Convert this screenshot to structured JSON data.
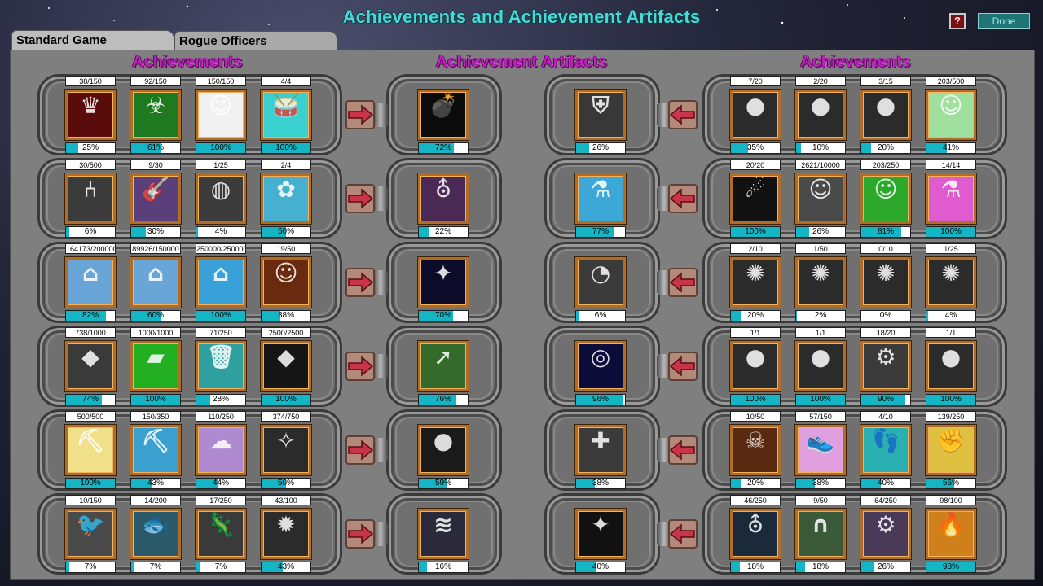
{
  "window": {
    "title": "Achievements and Achievement Artifacts",
    "help_label": "?",
    "done_label": "Done"
  },
  "tabs": [
    {
      "label": "Standard Game",
      "active": true
    },
    {
      "label": "Rogue Officers",
      "active": false
    }
  ],
  "headings": {
    "left": "Achievements",
    "middle": "Achievement Artifacts",
    "right": "Achievements"
  },
  "colors": {
    "progress_fill": "#14b6c6",
    "frame_border": "#b06d28",
    "heading": "#c21fc2",
    "title": "#48d8d8",
    "arrow": "#c8344a"
  },
  "rows": [
    {
      "left": [
        {
          "count": "38/150",
          "pct": "25%",
          "fill": 25,
          "icon": "magic-hat-icon",
          "bg": "#5a0c0c"
        },
        {
          "count": "92/150",
          "pct": "61%",
          "fill": 61,
          "icon": "biohazard-icon",
          "bg": "#1f7a1f"
        },
        {
          "count": "150/150",
          "pct": "100%",
          "fill": 100,
          "icon": "scientist-icon",
          "bg": "#f1f1f1"
        },
        {
          "count": "4/4",
          "pct": "100%",
          "fill": 100,
          "icon": "drum-icon",
          "bg": "#3ad0d0"
        }
      ],
      "left_artifact": {
        "pct": "72%",
        "fill": 72,
        "icon": "bomb-icon",
        "bg": "#0b0b0b"
      },
      "right_artifact": {
        "pct": "26%",
        "fill": 26,
        "icon": "shield-gear-icon",
        "bg": "#383838"
      },
      "right": [
        {
          "count": "7/20",
          "pct": "35%",
          "fill": 35,
          "icon": "moon-icon",
          "bg": "#2b2b2b"
        },
        {
          "count": "2/20",
          "pct": "10%",
          "fill": 10,
          "icon": "brown-planet-icon",
          "bg": "#2b2b2b"
        },
        {
          "count": "3/15",
          "pct": "20%",
          "fill": 20,
          "icon": "mars-icon",
          "bg": "#2b2b2b"
        },
        {
          "count": "203/500",
          "pct": "41%",
          "fill": 41,
          "icon": "zookeeper-icon",
          "bg": "#9fe09f"
        }
      ]
    },
    {
      "left": [
        {
          "count": "30/500",
          "pct": "6%",
          "fill": 6,
          "icon": "chair-icon",
          "bg": "#3b3b3b"
        },
        {
          "count": "9/30",
          "pct": "30%",
          "fill": 30,
          "icon": "guitar-icon",
          "bg": "#5b3f7a"
        },
        {
          "count": "1/25",
          "pct": "4%",
          "fill": 4,
          "icon": "copper-disc-icon",
          "bg": "#3b3b3b"
        },
        {
          "count": "2/4",
          "pct": "50%",
          "fill": 50,
          "icon": "spices-icon",
          "bg": "#46b0d0"
        }
      ],
      "left_artifact": {
        "pct": "22%",
        "fill": 22,
        "icon": "ufo-beam-icon",
        "bg": "#4a2a55"
      },
      "right_artifact": {
        "pct": "77%",
        "fill": 77,
        "icon": "flask-plus-icon",
        "bg": "#3ba8d8"
      },
      "right": [
        {
          "count": "20/20",
          "pct": "100%",
          "fill": 100,
          "icon": "comet-icon",
          "bg": "#111111"
        },
        {
          "count": "2621/10000",
          "pct": "26%",
          "fill": 26,
          "icon": "scientist-portrait-icon",
          "bg": "#4a4a4a"
        },
        {
          "count": "203/250",
          "pct": "81%",
          "fill": 81,
          "icon": "robber-icon",
          "bg": "#2ca82c"
        },
        {
          "count": "14/14",
          "pct": "100%",
          "fill": 100,
          "icon": "flasks-icon",
          "bg": "#e05ad0"
        }
      ]
    },
    {
      "left": [
        {
          "count": "164173/200000",
          "pct": "82%",
          "fill": 82,
          "icon": "house-for-sale-icon",
          "bg": "#6aa5d8"
        },
        {
          "count": "89926/150000",
          "pct": "60%",
          "fill": 60,
          "icon": "house-sold-icon",
          "bg": "#6aa5d8"
        },
        {
          "count": "250000/250000",
          "pct": "100%",
          "fill": 100,
          "icon": "shop-icon",
          "bg": "#3aa0d8"
        },
        {
          "count": "19/50",
          "pct": "38%",
          "fill": 38,
          "icon": "bearded-man-icon",
          "bg": "#6a2a10"
        }
      ],
      "left_artifact": {
        "pct": "70%",
        "fill": 70,
        "icon": "satellite-icon",
        "bg": "#0c0c2a"
      },
      "right_artifact": {
        "pct": "6%",
        "fill": 6,
        "icon": "gauge-icon",
        "bg": "#3b3b3b"
      },
      "right": [
        {
          "count": "2/10",
          "pct": "20%",
          "fill": 20,
          "icon": "galaxy-icon",
          "bg": "#2b2b2b"
        },
        {
          "count": "1/50",
          "pct": "2%",
          "fill": 2,
          "icon": "green-spiral-icon",
          "bg": "#2b2b2b"
        },
        {
          "count": "0/10",
          "pct": "0%",
          "fill": 0,
          "icon": "red-spiral-icon",
          "bg": "#2b2b2b"
        },
        {
          "count": "1/25",
          "pct": "4%",
          "fill": 4,
          "icon": "gold-spiral-icon",
          "bg": "#2b2b2b"
        }
      ]
    },
    {
      "left": [
        {
          "count": "738/1000",
          "pct": "74%",
          "fill": 74,
          "icon": "gold-nugget-icon",
          "bg": "#3a3a3a"
        },
        {
          "count": "1000/1000",
          "pct": "100%",
          "fill": 100,
          "icon": "silver-bar-icon",
          "bg": "#22b022"
        },
        {
          "count": "71/250",
          "pct": "28%",
          "fill": 28,
          "icon": "trash-can-icon",
          "bg": "#2ea0a0"
        },
        {
          "count": "2500/2500",
          "pct": "100%",
          "fill": 100,
          "icon": "gems-icon",
          "bg": "#151515"
        }
      ],
      "left_artifact": {
        "pct": "76%",
        "fill": 76,
        "icon": "map-arrow-icon",
        "bg": "#356b2a"
      },
      "right_artifact": {
        "pct": "96%",
        "fill": 96,
        "icon": "target-icon",
        "bg": "#0c0c3a"
      },
      "right": [
        {
          "count": "1/1",
          "pct": "100%",
          "fill": 100,
          "icon": "silver-planet-icon",
          "bg": "#2b2b2b"
        },
        {
          "count": "1/1",
          "pct": "100%",
          "fill": 100,
          "icon": "rainbow-orb-icon",
          "bg": "#2b2b2b"
        },
        {
          "count": "18/20",
          "pct": "90%",
          "fill": 90,
          "icon": "robot-parts-icon",
          "bg": "#3a3a3a"
        },
        {
          "count": "1/1",
          "pct": "100%",
          "fill": 100,
          "icon": "red-planet-icon",
          "bg": "#2b2b2b"
        }
      ]
    },
    {
      "left": [
        {
          "count": "500/500",
          "pct": "100%",
          "fill": 100,
          "icon": "crystal-drill-icon",
          "bg": "#f0e08a"
        },
        {
          "count": "150/350",
          "pct": "43%",
          "fill": 43,
          "icon": "oil-drill-icon",
          "bg": "#3aa0d0"
        },
        {
          "count": "110/250",
          "pct": "44%",
          "fill": 44,
          "icon": "cloud-drill-icon",
          "bg": "#b08ad0"
        },
        {
          "count": "374/750",
          "pct": "50%",
          "fill": 50,
          "icon": "insect-icon",
          "bg": "#2b2b2b"
        }
      ],
      "left_artifact": {
        "pct": "59%",
        "fill": 59,
        "icon": "green-planet-icon",
        "bg": "#1a1a1a"
      },
      "right_artifact": {
        "pct": "38%",
        "fill": 38,
        "icon": "hands-plus-icon",
        "bg": "#3b3b3b"
      },
      "right": [
        {
          "count": "10/50",
          "pct": "20%",
          "fill": 20,
          "icon": "pirate-icon",
          "bg": "#5a2a10"
        },
        {
          "count": "57/150",
          "pct": "38%",
          "fill": 38,
          "icon": "winged-shoe-icon",
          "bg": "#e0a0e0"
        },
        {
          "count": "4/10",
          "pct": "40%",
          "fill": 40,
          "icon": "feet-icon",
          "bg": "#2ab0b0"
        },
        {
          "count": "139/250",
          "pct": "56%",
          "fill": 56,
          "icon": "fist-icon",
          "bg": "#e0c040"
        }
      ]
    },
    {
      "left": [
        {
          "count": "10/150",
          "pct": "7%",
          "fill": 7,
          "icon": "bird-icon",
          "bg": "#4a4a4a"
        },
        {
          "count": "14/200",
          "pct": "7%",
          "fill": 7,
          "icon": "fish-icon",
          "bg": "#2a5a6a"
        },
        {
          "count": "17/250",
          "pct": "7%",
          "fill": 7,
          "icon": "lizard-icon",
          "bg": "#3a3a3a"
        },
        {
          "count": "43/100",
          "pct": "43%",
          "fill": 43,
          "icon": "virus-icon",
          "bg": "#2b2b2b"
        }
      ],
      "left_artifact": {
        "pct": "16%",
        "fill": 16,
        "icon": "dna-icon",
        "bg": "#2a2a3a"
      },
      "right_artifact": {
        "pct": "40%",
        "fill": 40,
        "icon": "wand-spiral-icon",
        "bg": "#111111"
      },
      "right": [
        {
          "count": "46/250",
          "pct": "18%",
          "fill": 18,
          "icon": "ufo-icon",
          "bg": "#1a2a3a"
        },
        {
          "count": "9/50",
          "pct": "18%",
          "fill": 18,
          "icon": "horseshoe-icon",
          "bg": "#3a5a3a"
        },
        {
          "count": "64/250",
          "pct": "26%",
          "fill": 26,
          "icon": "gear-cluster-icon",
          "bg": "#4a3a5a"
        },
        {
          "count": "98/100",
          "pct": "98%",
          "fill": 98,
          "icon": "fire-ship-icon",
          "bg": "#d0801a"
        }
      ]
    }
  ]
}
